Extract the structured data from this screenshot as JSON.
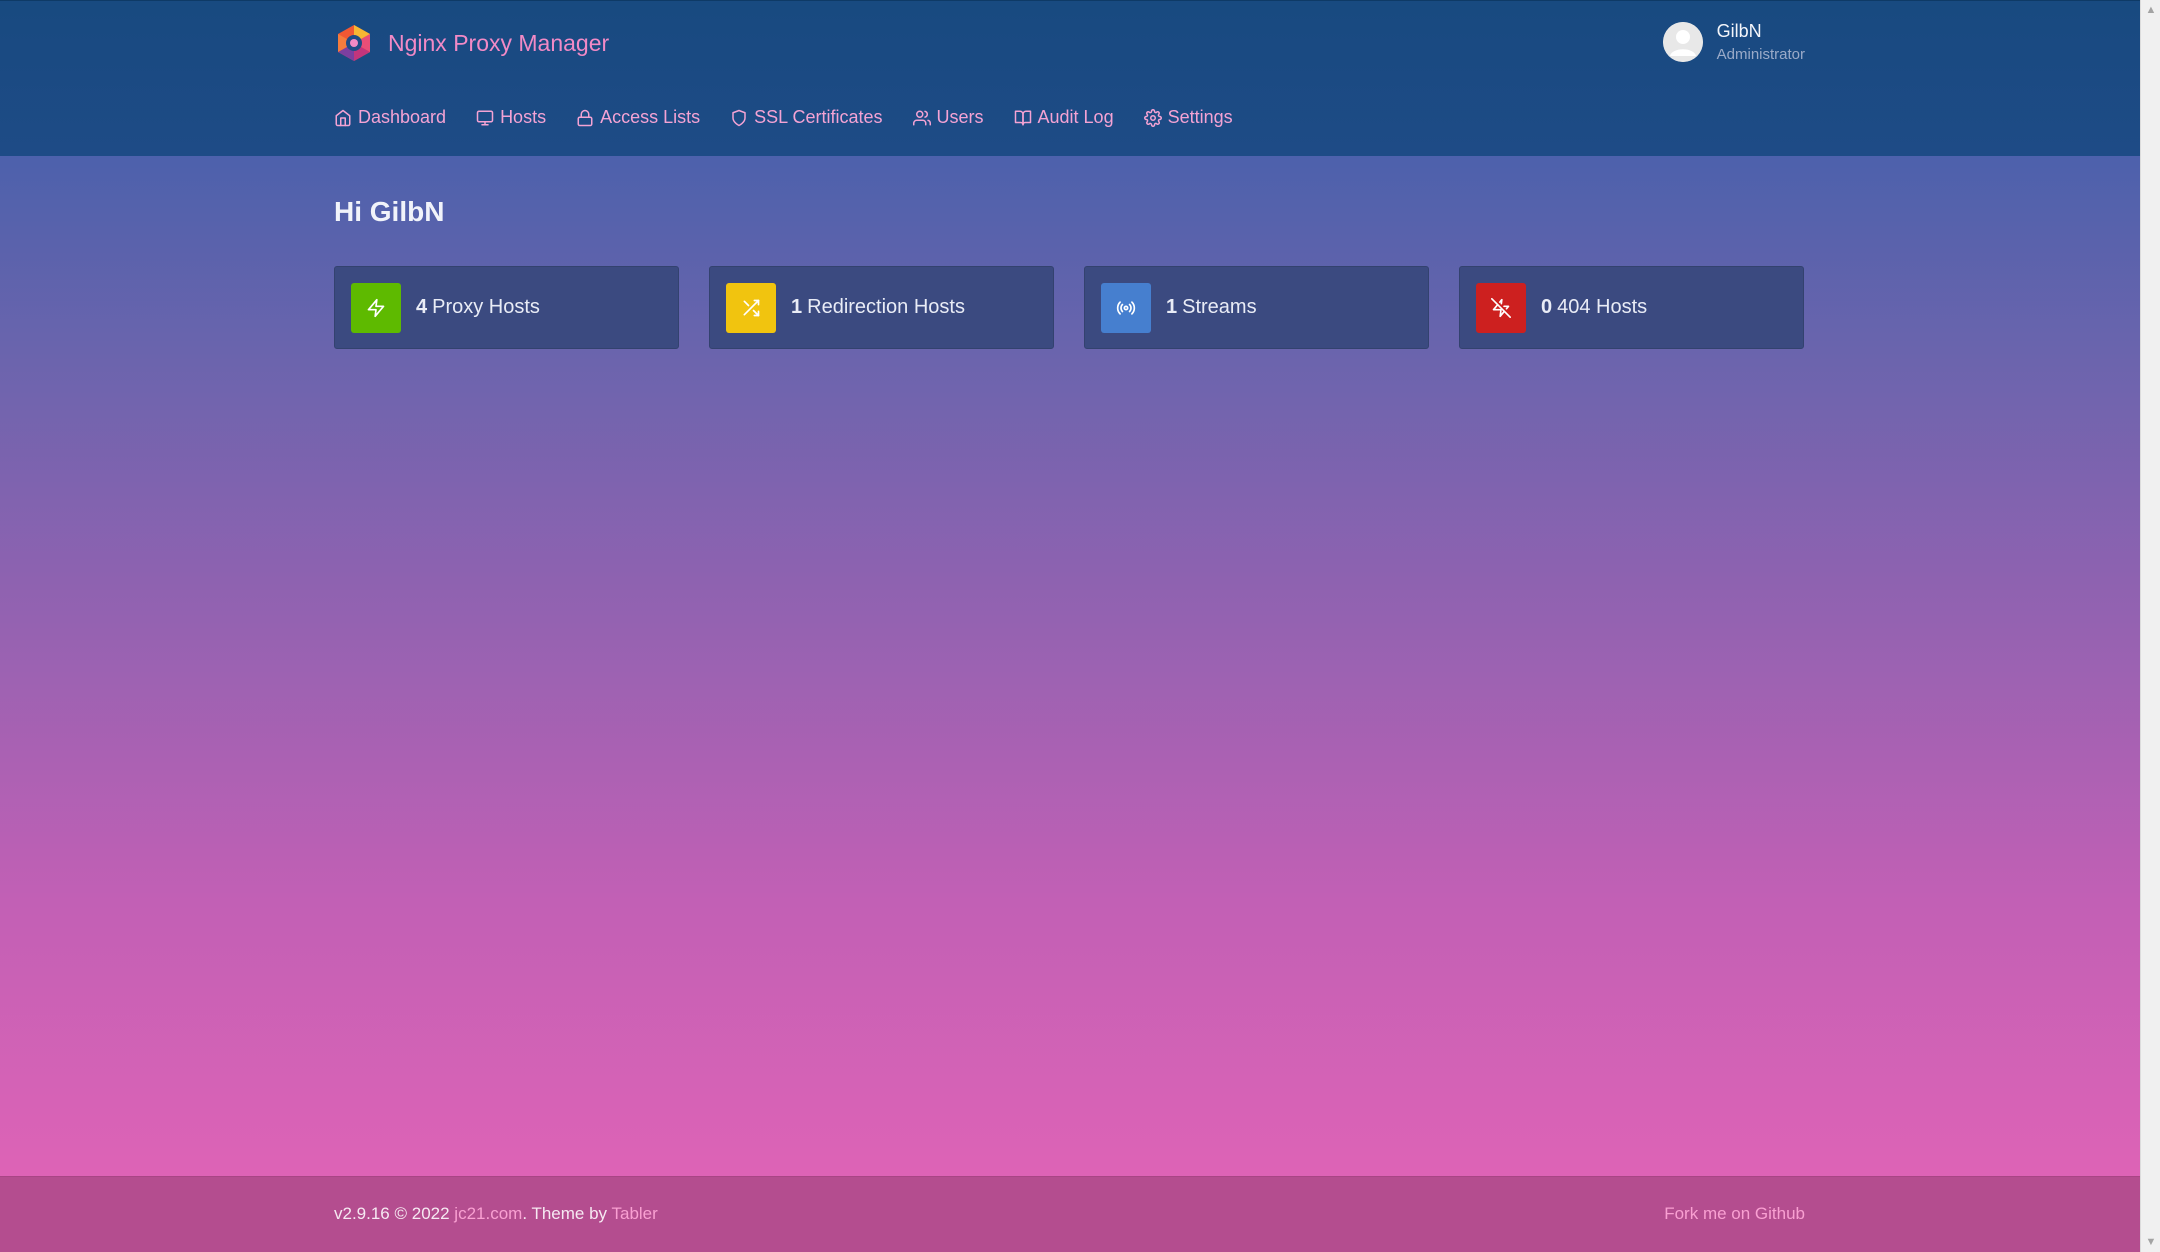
{
  "header": {
    "brand_name": "Nginx Proxy Manager",
    "user": {
      "name": "GilbN",
      "role": "Administrator"
    },
    "nav": [
      {
        "label": "Dashboard",
        "icon": "home-icon"
      },
      {
        "label": "Hosts",
        "icon": "monitor-icon"
      },
      {
        "label": "Access Lists",
        "icon": "lock-icon"
      },
      {
        "label": "SSL Certificates",
        "icon": "shield-icon"
      },
      {
        "label": "Users",
        "icon": "users-icon"
      },
      {
        "label": "Audit Log",
        "icon": "book-icon"
      },
      {
        "label": "Settings",
        "icon": "gear-icon"
      }
    ]
  },
  "main": {
    "greeting": "Hi GilbN",
    "cards": [
      {
        "count": "4",
        "label": "Proxy Hosts",
        "icon": "zap-icon",
        "color": "#5eba00"
      },
      {
        "count": "1",
        "label": "Redirection Hosts",
        "icon": "shuffle-icon",
        "color": "#f1c40f"
      },
      {
        "count": "1",
        "label": "Streams",
        "icon": "radio-icon",
        "color": "#467fcf"
      },
      {
        "count": "0",
        "label": "404 Hosts",
        "icon": "zap-off-icon",
        "color": "#cd201f"
      }
    ]
  },
  "footer": {
    "version": "v2.9.16 © 2022",
    "author_link": "jc21.com",
    "theme_text": ". Theme by",
    "theme_link": "Tabler",
    "fork_link": "Fork me on Github"
  },
  "colors": {
    "brand": "#f28ac6",
    "nav_link": "#f4a3d4",
    "header_bg": "#184a80",
    "card_bg": "#3b4a80",
    "footer_bg": "#b44d8f"
  }
}
